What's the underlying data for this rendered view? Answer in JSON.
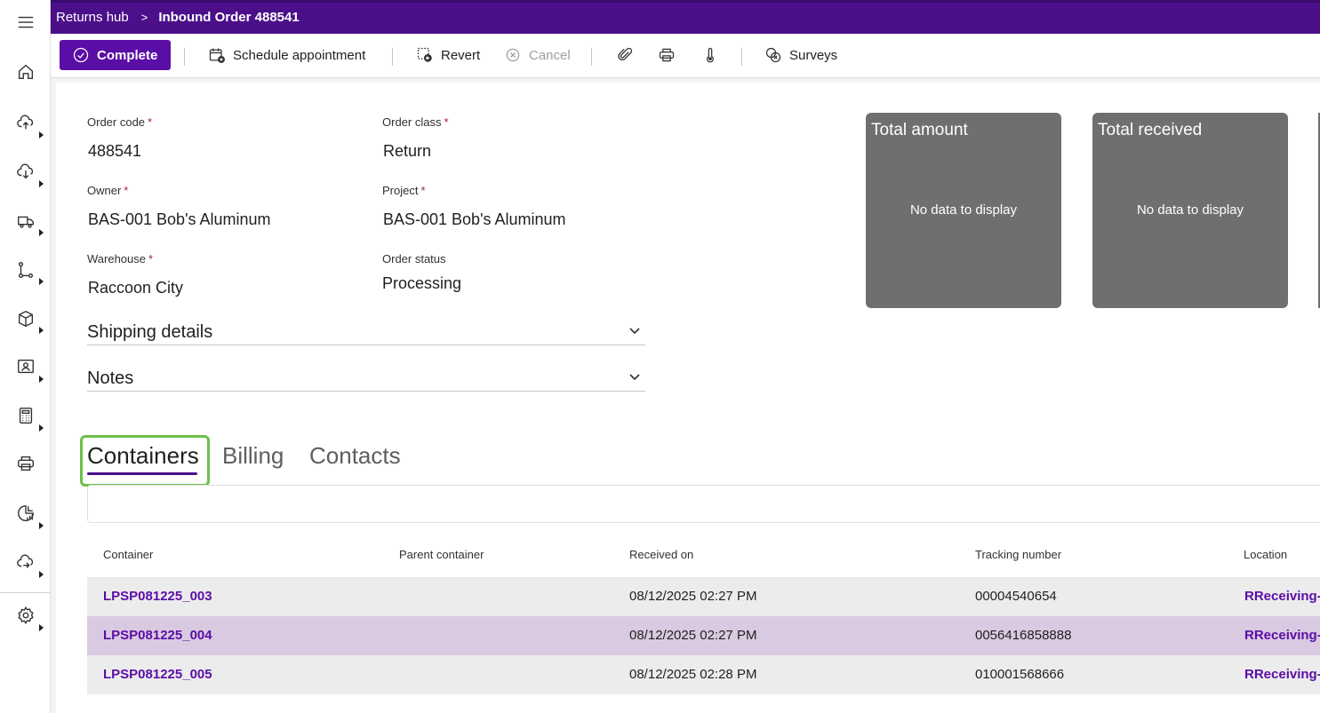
{
  "breadcrumb": {
    "parent": "Returns hub",
    "separator": ">",
    "current": "Inbound Order 488541"
  },
  "rail": {
    "items": [
      {
        "icon": "hamburger-menu-icon"
      },
      {
        "icon": "home-icon"
      },
      {
        "icon": "cloud-upload-icon"
      },
      {
        "icon": "cloud-download-icon"
      },
      {
        "icon": "truck-icon"
      },
      {
        "icon": "workflow-icon"
      },
      {
        "icon": "package-icon"
      },
      {
        "icon": "contact-card-icon"
      },
      {
        "icon": "calculator-icon"
      },
      {
        "icon": "printer-icon"
      },
      {
        "icon": "report-chart-icon"
      },
      {
        "icon": "cloud-sync-icon"
      },
      {
        "icon": "settings-gear-icon"
      }
    ]
  },
  "toolbar": {
    "complete": "Complete",
    "schedule": "Schedule appointment",
    "revert": "Revert",
    "cancel": "Cancel",
    "surveys": "Surveys"
  },
  "form": {
    "order_code_label": "Order code",
    "order_code": "488541",
    "order_class_label": "Order class",
    "order_class": "Return",
    "owner_label": "Owner",
    "owner": "BAS-001 Bob's Aluminum",
    "project_label": "Project",
    "project": "BAS-001 Bob's Aluminum",
    "warehouse_label": "Warehouse",
    "warehouse": "Raccoon City",
    "status_label": "Order status",
    "status": "Processing",
    "required_mark": "*"
  },
  "sections": {
    "shipping": "Shipping details",
    "notes": "Notes"
  },
  "tiles": [
    {
      "title": "Total amount",
      "empty": "No data to display"
    },
    {
      "title": "Total received",
      "empty": "No data to display"
    }
  ],
  "tabs": {
    "containers": "Containers",
    "billing": "Billing",
    "contacts": "Contacts"
  },
  "table": {
    "headers": [
      "Container",
      "Parent container",
      "Received on",
      "Tracking number",
      "Location"
    ],
    "rows": [
      {
        "container": "LPSP081225_003",
        "parent": "",
        "received": "08/12/2025 02:27 PM",
        "tracking": "00004540654",
        "location": "RReceiving-"
      },
      {
        "container": "LPSP081225_004",
        "parent": "",
        "received": "08/12/2025 02:27 PM",
        "tracking": "0056416858888",
        "location": "RReceiving-"
      },
      {
        "container": "LPSP081225_005",
        "parent": "",
        "received": "08/12/2025 02:28 PM",
        "tracking": "010001568666",
        "location": "RReceiving-"
      }
    ]
  },
  "colors": {
    "brand": "#4b0f8a",
    "primary_button": "#5b0ea6",
    "tile": "#6f6f6f",
    "highlight": "#6cc04a",
    "selected_row": "#d9cae1"
  }
}
